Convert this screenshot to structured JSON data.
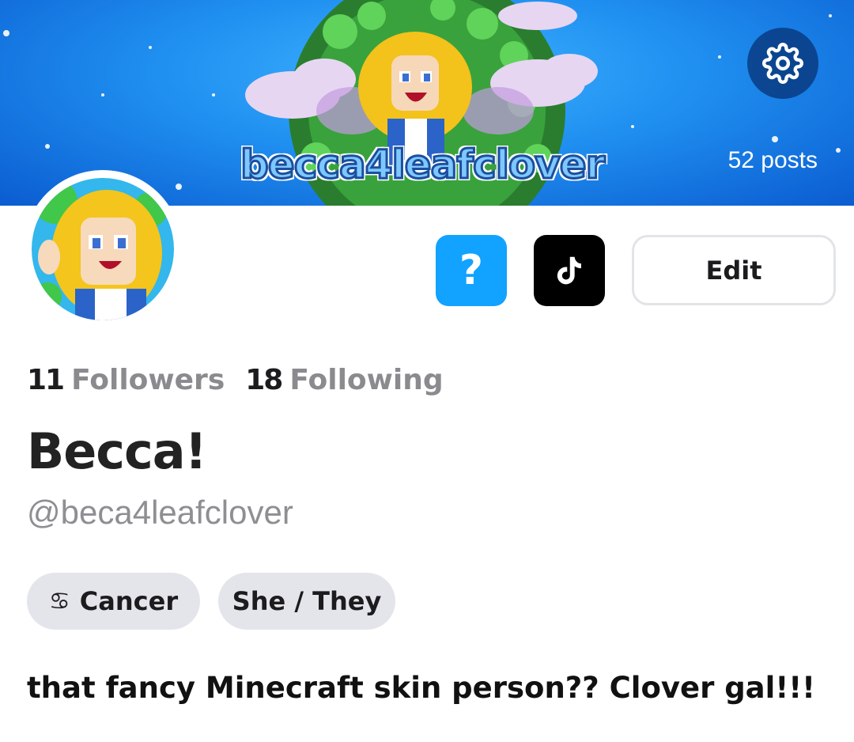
{
  "banner": {
    "title": "becca4leafclover",
    "posts_label": "52 posts"
  },
  "settings": {
    "icon": "gear-icon"
  },
  "actions": {
    "help_label": "?",
    "tiktok_icon": "tiktok-icon",
    "edit_label": "Edit"
  },
  "stats": {
    "followers_count": "11",
    "followers_label": "Followers",
    "following_count": "18",
    "following_label": "Following"
  },
  "profile": {
    "display_name": "Becca!",
    "handle": "@beca4leafclover",
    "zodiac_icon": "♋",
    "zodiac_label": "Cancer",
    "pronouns": "She / They",
    "bio": "that fancy Minecraft skin person?? Clover gal!!!"
  },
  "colors": {
    "banner_blue": "#1f8ff0",
    "help_button": "#12a2ff",
    "tiktok_button": "#000000",
    "chip_bg": "#e4e5ea",
    "muted_text": "#8a8a8f"
  }
}
